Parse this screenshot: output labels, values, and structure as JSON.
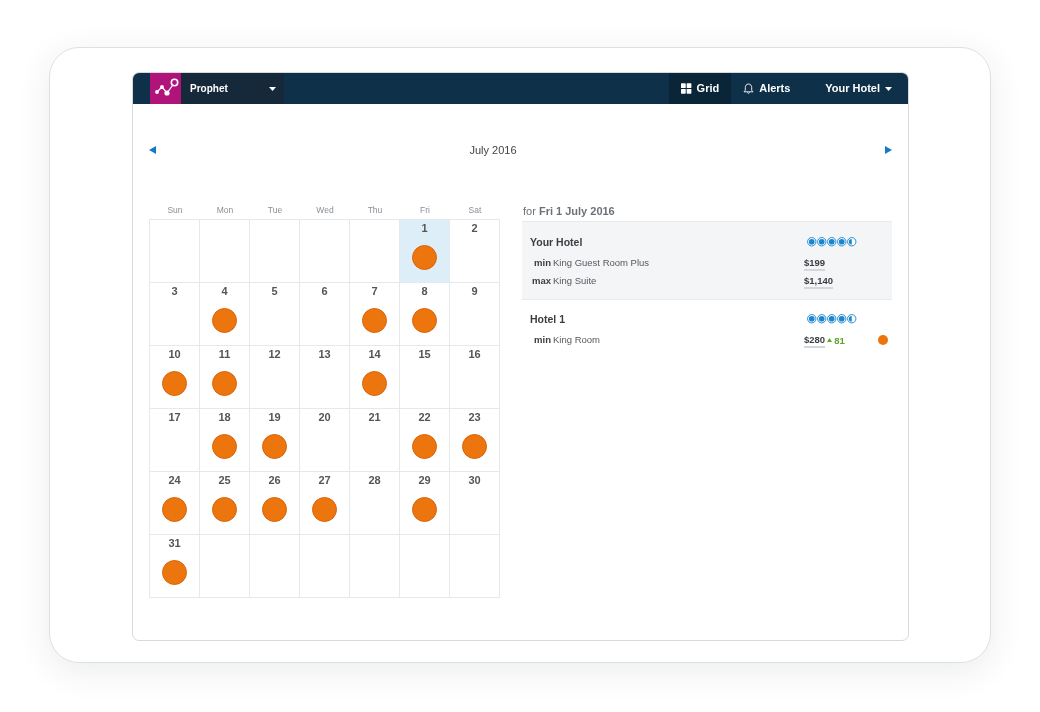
{
  "navbar": {
    "product_menu": "Prophet",
    "items": [
      {
        "label": "Grid",
        "kind": "grid",
        "selected": true
      },
      {
        "label": "Alerts",
        "kind": "alerts",
        "selected": false
      }
    ],
    "hotel_menu": "Your Hotel"
  },
  "calendar": {
    "month": "July 2016",
    "weekdays": [
      "Sun",
      "Mon",
      "Tue",
      "Wed",
      "Thu",
      "Fri",
      "Sat"
    ],
    "days": [
      {
        "kind": "blank"
      },
      {
        "kind": "blank"
      },
      {
        "kind": "blank"
      },
      {
        "kind": "blank"
      },
      {
        "kind": "blank"
      },
      {
        "kind": "day",
        "day": "1",
        "selected": true,
        "alert": true
      },
      {
        "kind": "day",
        "day": "2",
        "selected": false,
        "alert": false
      },
      {
        "kind": "day",
        "day": "3",
        "selected": false,
        "alert": false
      },
      {
        "kind": "day",
        "day": "4",
        "selected": false,
        "alert": true
      },
      {
        "kind": "day",
        "day": "5",
        "selected": false,
        "alert": false
      },
      {
        "kind": "day",
        "day": "6",
        "selected": false,
        "alert": false
      },
      {
        "kind": "day",
        "day": "7",
        "selected": false,
        "alert": true
      },
      {
        "kind": "day",
        "day": "8",
        "selected": false,
        "alert": true
      },
      {
        "kind": "day",
        "day": "9",
        "selected": false,
        "alert": false
      },
      {
        "kind": "day",
        "day": "10",
        "selected": false,
        "alert": true
      },
      {
        "kind": "day",
        "day": "11",
        "selected": false,
        "alert": true
      },
      {
        "kind": "day",
        "day": "12",
        "selected": false,
        "alert": false
      },
      {
        "kind": "day",
        "day": "13",
        "selected": false,
        "alert": false
      },
      {
        "kind": "day",
        "day": "14",
        "selected": false,
        "alert": true
      },
      {
        "kind": "day",
        "day": "15",
        "selected": false,
        "alert": false
      },
      {
        "kind": "day",
        "day": "16",
        "selected": false,
        "alert": false
      },
      {
        "kind": "day",
        "day": "17",
        "selected": false,
        "alert": false
      },
      {
        "kind": "day",
        "day": "18",
        "selected": false,
        "alert": true
      },
      {
        "kind": "day",
        "day": "19",
        "selected": false,
        "alert": true
      },
      {
        "kind": "day",
        "day": "20",
        "selected": false,
        "alert": false
      },
      {
        "kind": "day",
        "day": "21",
        "selected": false,
        "alert": false
      },
      {
        "kind": "day",
        "day": "22",
        "selected": false,
        "alert": true
      },
      {
        "kind": "day",
        "day": "23",
        "selected": false,
        "alert": true
      },
      {
        "kind": "day",
        "day": "24",
        "selected": false,
        "alert": true
      },
      {
        "kind": "day",
        "day": "25",
        "selected": false,
        "alert": true
      },
      {
        "kind": "day",
        "day": "26",
        "selected": false,
        "alert": true
      },
      {
        "kind": "day",
        "day": "27",
        "selected": false,
        "alert": true
      },
      {
        "kind": "day",
        "day": "28",
        "selected": false,
        "alert": false
      },
      {
        "kind": "day",
        "day": "29",
        "selected": false,
        "alert": true
      },
      {
        "kind": "day",
        "day": "30",
        "selected": false,
        "alert": false
      },
      {
        "kind": "day",
        "day": "31",
        "selected": false,
        "alert": true
      }
    ]
  },
  "details": {
    "heading": "for **Fri 1 July 2016**",
    "hotels": [
      {
        "name": "Your Hotel",
        "own": true,
        "stars": 4.5,
        "alert": false,
        "rates": [
          {
            "label": "min",
            "room": "King Guest Room Plus",
            "price": "$199"
          },
          {
            "label": "max",
            "room": "King Suite",
            "price": "$1,140"
          }
        ]
      },
      {
        "name": "Hotel 1",
        "own": false,
        "stars": 4.5,
        "alert": true,
        "rates": [
          {
            "label": "min",
            "room": "King Room",
            "price": "$280",
            "rising": true,
            "change": "81"
          }
        ]
      }
    ]
  }
}
